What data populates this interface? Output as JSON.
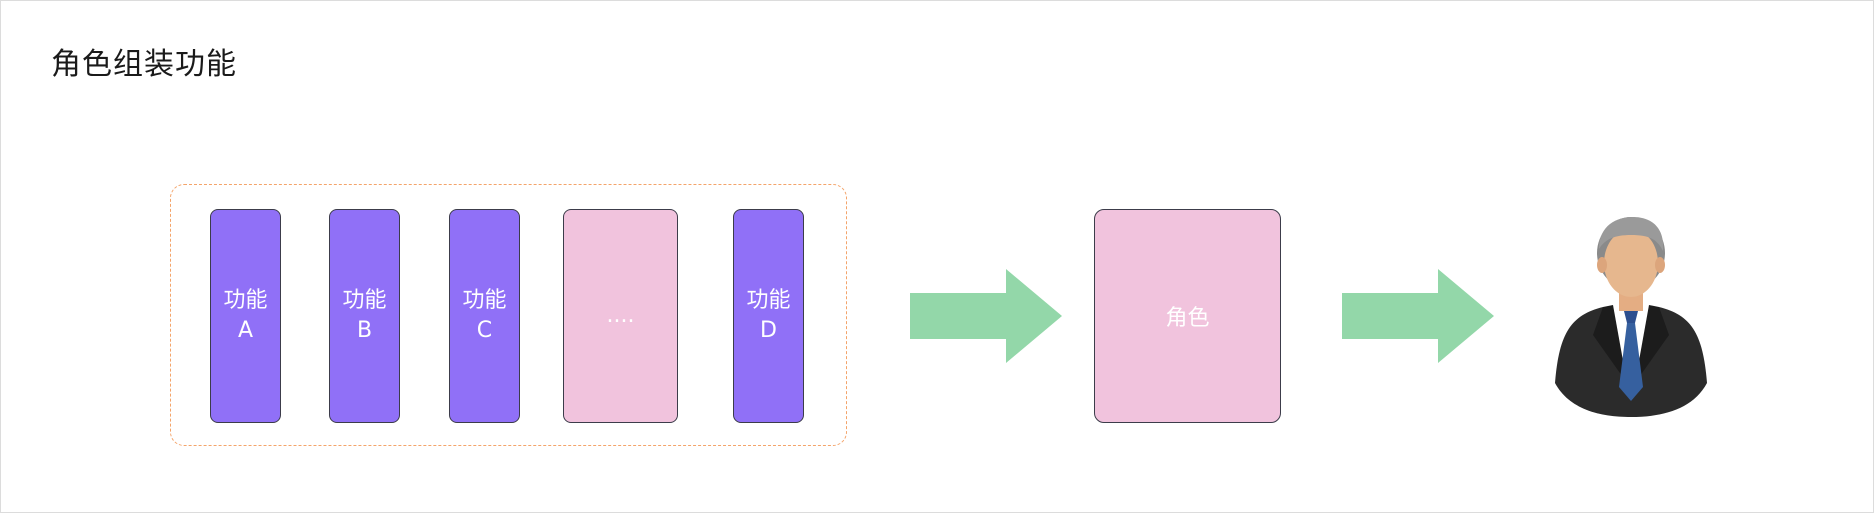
{
  "title": "角色组装功能",
  "functions": [
    {
      "line1": "功能",
      "line2": "A"
    },
    {
      "line1": "功能",
      "line2": "B"
    },
    {
      "line1": "功能",
      "line2": "C"
    },
    {
      "line1": "....",
      "line2": ""
    },
    {
      "line1": "功能",
      "line2": "D"
    }
  ],
  "role_label": "角色",
  "icons": {
    "arrow": "right-arrow-icon",
    "user": "businessman-icon"
  },
  "colors": {
    "function_box": "#9070f7",
    "placeholder_box": "#f1c3dd",
    "role_box": "#f1c3dd",
    "group_border": "#f4a46a",
    "arrow": "#93d7a9"
  }
}
